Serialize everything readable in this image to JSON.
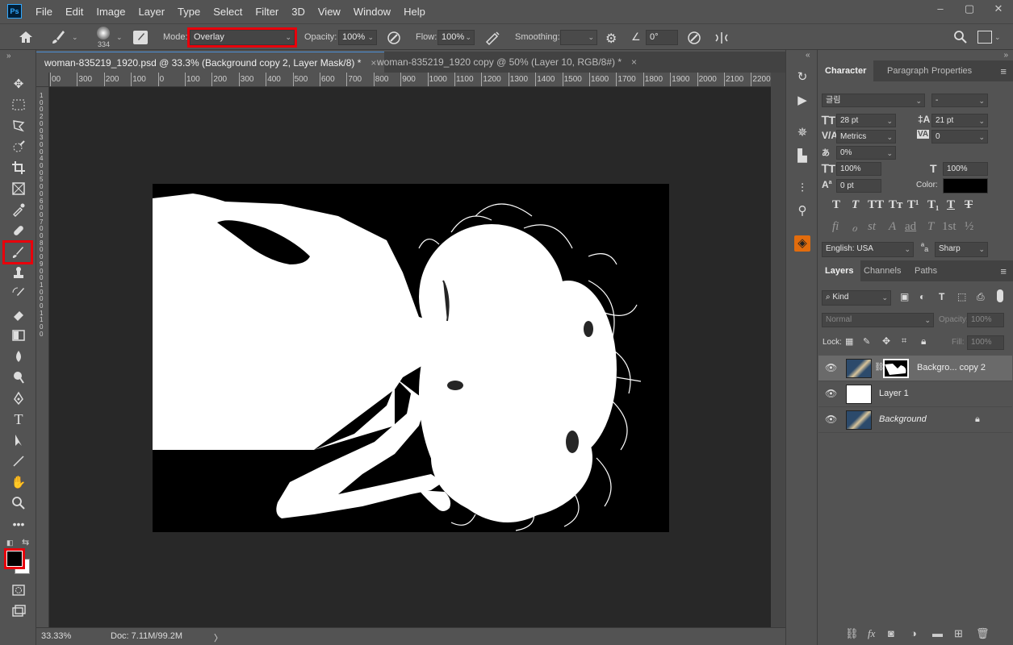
{
  "app": {
    "logo": "Ps"
  },
  "menu": [
    "File",
    "Edit",
    "Image",
    "Layer",
    "Type",
    "Select",
    "Filter",
    "3D",
    "View",
    "Window",
    "Help"
  ],
  "window_controls": {
    "minimize": "–",
    "restore": "▢",
    "close": "✕"
  },
  "options": {
    "brush_size": "334",
    "mode_label": "Mode:",
    "mode_value": "Overlay",
    "opacity_label": "Opacity:",
    "opacity_value": "100%",
    "flow_label": "Flow:",
    "flow_value": "100%",
    "smoothing_label": "Smoothing:",
    "smoothing_value": "",
    "angle_value": "0°"
  },
  "tabs": [
    {
      "label": "woman-835219_1920.psd @ 33.3% (Background copy 2, Layer Mask/8) *",
      "close": "×"
    },
    {
      "label": "woman-835219_1920 copy @ 50% (Layer 10, RGB/8#) *",
      "close": "×"
    }
  ],
  "ruler_labels": [
    "00",
    "300",
    "200",
    "100",
    "0",
    "100",
    "200",
    "300",
    "400",
    "500",
    "600",
    "700",
    "800",
    "900",
    "1000",
    "1100",
    "1200",
    "1300",
    "1400",
    "1500",
    "1600",
    "1700",
    "1800",
    "1900",
    "2000",
    "2100",
    "2200"
  ],
  "ruler_left_labels": [
    "1",
    "0",
    "0",
    "2",
    "0",
    "0",
    "3",
    "0",
    "0",
    "4",
    "0",
    "0",
    "5",
    "0",
    "0",
    "6",
    "0",
    "0",
    "7",
    "0",
    "0",
    "8",
    "0",
    "0",
    "9",
    "0",
    "0",
    "1",
    "0",
    "0",
    "0",
    "1",
    "1",
    "0",
    "0"
  ],
  "status": {
    "zoom": "33.33%",
    "doc": "Doc: 7.11M/99.2M",
    "arrow": "〉"
  },
  "character": {
    "tabs": [
      "Character",
      "Paragraph",
      "Properties"
    ],
    "font_family": "글림",
    "font_style": "-",
    "font_size": "28 pt",
    "leading": "21 pt",
    "kerning": "Metrics",
    "tracking": "0",
    "tsume": "0%",
    "vscale": "100%",
    "hscale": "100%",
    "baseline": "0 pt",
    "color_label": "Color:",
    "language": "English: USA",
    "antialias": "Sharp",
    "styles": [
      "T",
      "T",
      "TT",
      "Tт",
      "T¹",
      "T₁",
      "T",
      "T"
    ],
    "opentype": [
      "fi",
      "ℴ",
      "st",
      "A",
      "ad",
      "T",
      "1st",
      "½"
    ]
  },
  "layers_panel": {
    "tabs": [
      "Layers",
      "Channels",
      "Paths"
    ],
    "filter_kind": "Kind",
    "blend_mode": "Normal",
    "opacity_label": "Opacity:",
    "opacity_value": "100%",
    "lock_label": "Lock:",
    "fill_label": "Fill:",
    "fill_value": "100%",
    "layers": [
      {
        "name": "Backgro... copy 2",
        "selected": true
      },
      {
        "name": "Layer 1",
        "selected": false
      },
      {
        "name": "Background",
        "selected": false
      }
    ]
  },
  "colors": {
    "highlight": "#e8000b",
    "bg": "#535353",
    "canvas": "#282828"
  }
}
